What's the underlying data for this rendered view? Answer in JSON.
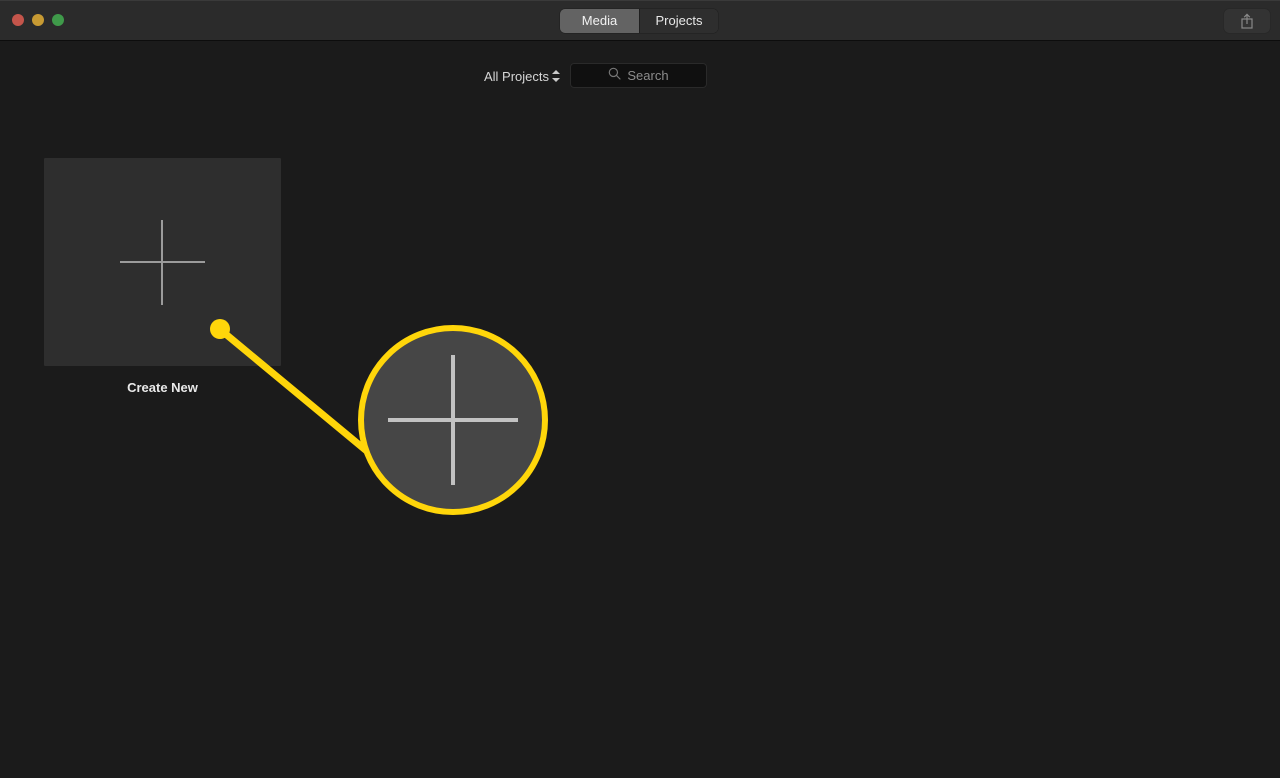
{
  "window": {
    "traffic_lights": [
      {
        "name": "close",
        "color": "#c4554b"
      },
      {
        "name": "minimize",
        "color": "#c79a33"
      },
      {
        "name": "zoom",
        "color": "#3f9a4a"
      }
    ]
  },
  "toolbar": {
    "tabs": [
      {
        "label": "Media",
        "active": true
      },
      {
        "label": "Projects",
        "active": false
      }
    ],
    "share_button": {
      "icon": "share-icon",
      "label": ""
    }
  },
  "filter_bar": {
    "library_selector": {
      "label": "All Projects",
      "icon": "up-down-chevron-icon"
    },
    "search": {
      "icon": "search-icon",
      "placeholder": "Search",
      "value": ""
    }
  },
  "library": {
    "items": [
      {
        "label": "Create New",
        "icon": "plus-icon"
      }
    ]
  },
  "annotation": {
    "highlight_color": "#FFD60A",
    "target": "Create New",
    "magnified_icon": "plus-icon"
  }
}
